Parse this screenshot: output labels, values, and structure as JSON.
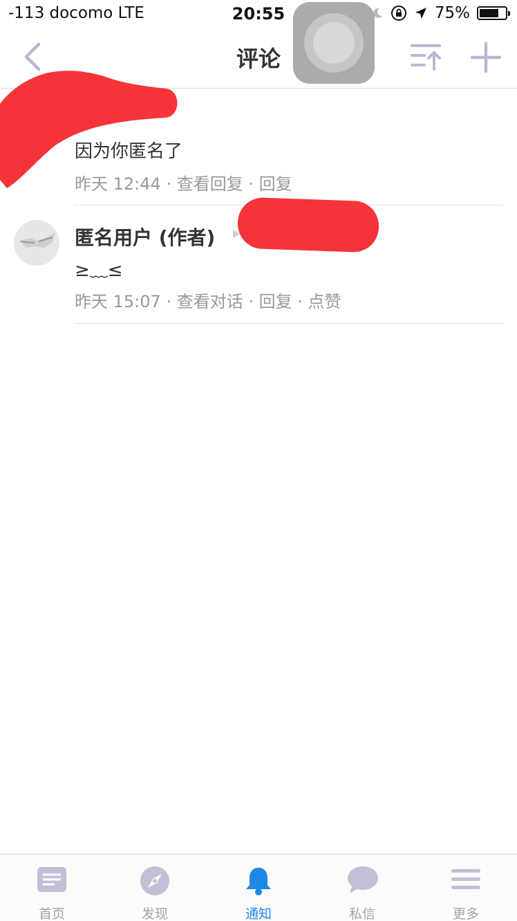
{
  "status_bar": {
    "carrier": "-113 docomo  LTE",
    "time": "20:55",
    "battery_percent": "75%",
    "battery_level": 0.75,
    "icons": [
      "moon-icon",
      "orientation-lock-icon",
      "location-arrow-icon",
      "battery-icon"
    ]
  },
  "nav": {
    "title": "评论",
    "icons": [
      "back-chevron-icon",
      "sort-up-icon",
      "plus-icon"
    ]
  },
  "colors": {
    "accent": "#1e88e5",
    "nav_icon": "#b9b6d6",
    "tab_icon": "#c2bfd6",
    "redaction": "#f5343a"
  },
  "comments": [
    {
      "username": "",
      "text": "因为你匿名了",
      "time": "昨天 12:44",
      "actions": [
        "查看回复",
        "回复"
      ]
    },
    {
      "username": "匿名用户 (作者)",
      "text": "≥﹏≤",
      "time": "昨天 15:07",
      "actions": [
        "查看对话",
        "回复",
        "点赞"
      ]
    }
  ],
  "tabs": [
    {
      "label": "首页",
      "icon": "home-icon",
      "active": false
    },
    {
      "label": "发现",
      "icon": "compass-icon",
      "active": false
    },
    {
      "label": "通知",
      "icon": "bell-icon",
      "active": true
    },
    {
      "label": "私信",
      "icon": "chat-bubble-icon",
      "active": false
    },
    {
      "label": "更多",
      "icon": "menu-icon",
      "active": false
    }
  ]
}
